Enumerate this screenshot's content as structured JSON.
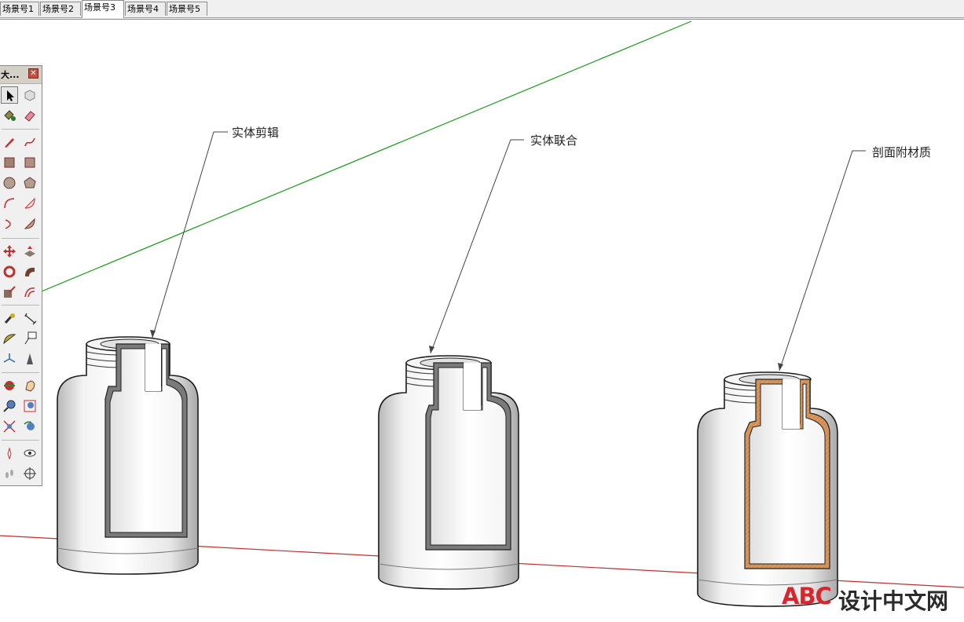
{
  "scene_tabs": [
    {
      "label": "场景号1"
    },
    {
      "label": "场景号2"
    },
    {
      "label": "场景号3",
      "active": true
    },
    {
      "label": "场景号4"
    },
    {
      "label": "场景号5"
    }
  ],
  "toolbar": {
    "title": "大...",
    "close_glyph": "✕",
    "tools": [
      "select-icon",
      "make-component-icon",
      "paint-bucket-icon",
      "eraser-icon",
      "pencil-icon",
      "freehand-icon",
      "rectangle-icon",
      "rotated-rectangle-icon",
      "circle-icon",
      "polygon-icon",
      "arc-icon",
      "pie-icon",
      "two-point-arc-icon",
      "three-point-arc-icon",
      "move-icon",
      "push-pull-icon",
      "rotate-icon",
      "follow-me-icon",
      "scale-icon",
      "offset-icon",
      "tape-measure-icon",
      "dimension-icon",
      "protractor-icon",
      "text-icon",
      "axes-icon",
      "3d-text-icon",
      "orbit-icon",
      "pan-icon",
      "zoom-icon",
      "zoom-window-icon",
      "zoom-extents-icon",
      "previous-view-icon",
      "position-camera-icon",
      "look-around-icon",
      "walk-icon",
      "section-plane-icon"
    ]
  },
  "annotations": [
    {
      "text": "实体剪辑"
    },
    {
      "text": "实体联合"
    },
    {
      "text": "剖面附材质"
    }
  ],
  "colors": {
    "green_axis": "#1a9a1a",
    "red_axis": "#c0302e",
    "section_material": "#d8965c",
    "section_fill": "#7a7a7a",
    "watermark_red": "#d8262d"
  },
  "watermark": {
    "logo": "ABC",
    "site": "设计中文网"
  }
}
